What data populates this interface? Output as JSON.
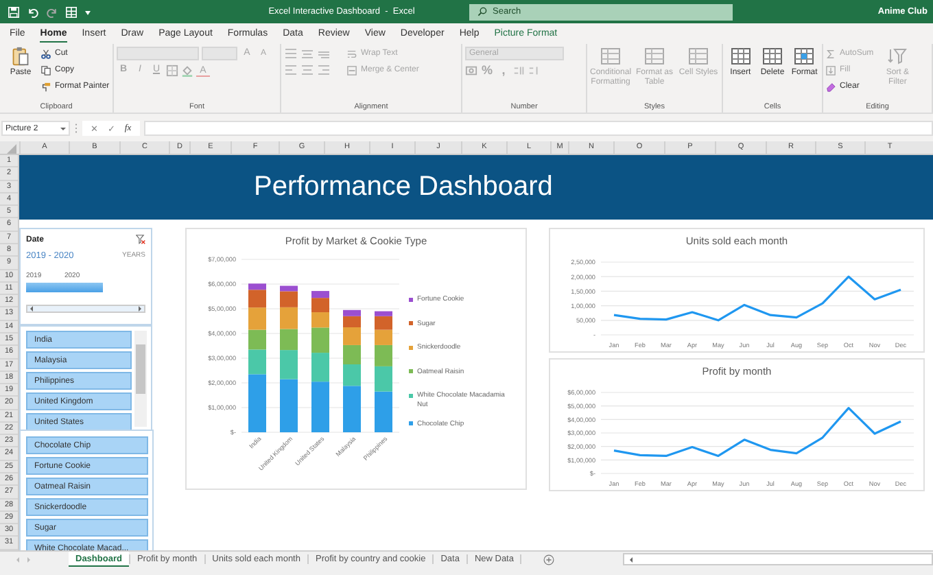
{
  "title_bar": {
    "quick_access": [
      {
        "kind": "save",
        "disabled": false
      },
      {
        "kind": "undo",
        "disabled": false
      },
      {
        "kind": "redo",
        "disabled": true
      },
      {
        "kind": "form",
        "disabled": false
      }
    ],
    "title": "Excel Interactive Dashboard  -  Excel",
    "search": {
      "placeholder": "Search"
    },
    "account": "Anime Club"
  },
  "menu_tabs": [
    {
      "label": "File",
      "selected": false,
      "contextual": false
    },
    {
      "label": "Home",
      "selected": true,
      "contextual": false
    },
    {
      "label": "Insert",
      "selected": false,
      "contextual": false
    },
    {
      "label": "Draw",
      "selected": false,
      "contextual": false
    },
    {
      "label": "Page Layout",
      "selected": false,
      "contextual": false
    },
    {
      "label": "Formulas",
      "selected": false,
      "contextual": false
    },
    {
      "label": "Data",
      "selected": false,
      "contextual": false
    },
    {
      "label": "Review",
      "selected": false,
      "contextual": false
    },
    {
      "label": "View",
      "selected": false,
      "contextual": false
    },
    {
      "label": "Developer",
      "selected": false,
      "contextual": false
    },
    {
      "label": "Help",
      "selected": false,
      "contextual": false
    },
    {
      "label": "Picture Format",
      "selected": false,
      "contextual": true
    }
  ],
  "ribbon": {
    "clipboard": {
      "label": "Clipboard",
      "paste": {
        "label": "Paste",
        "disabled": false
      },
      "tools": [
        {
          "label": "Cut",
          "disabled": false
        },
        {
          "label": "Copy",
          "disabled": false
        },
        {
          "label": "Format Painter",
          "disabled": false
        }
      ]
    },
    "font": {
      "label": "Font",
      "fields_disabled": true,
      "grow": "A",
      "shrink": "A",
      "styles": [
        {
          "label": "B",
          "disabled": true
        },
        {
          "label": "I",
          "disabled": true
        },
        {
          "label": "U",
          "disabled": true
        }
      ],
      "font_color": "A"
    },
    "alignment": {
      "label": "Alignment",
      "wrap_text": {
        "label": "Wrap Text",
        "disabled": true
      },
      "merge": {
        "label": "Merge & Center",
        "disabled": true
      }
    },
    "number": {
      "label": "Number",
      "format": {
        "value": "General",
        "disabled": true
      },
      "percent": "%",
      "comma": ","
    },
    "styles": {
      "label": "Styles",
      "buttons": [
        {
          "label": "Conditional Formatting",
          "disabled": true
        },
        {
          "label": "Format as Table",
          "disabled": true
        },
        {
          "label": "Cell Styles",
          "disabled": true
        }
      ]
    },
    "cells": {
      "label": "Cells",
      "buttons": [
        {
          "label": "Insert",
          "disabled": false
        },
        {
          "label": "Delete",
          "disabled": false
        },
        {
          "label": "Format",
          "disabled": false
        }
      ]
    },
    "editing": {
      "label": "Editing",
      "tools": [
        {
          "label": "AutoSum",
          "disabled": true
        },
        {
          "label": "Fill",
          "disabled": true
        },
        {
          "label": "Clear",
          "disabled": false
        }
      ],
      "sort_filter": {
        "label": "Sort & Filter",
        "disabled": true
      }
    }
  },
  "formula_bar": {
    "name_box": "Picture 2",
    "cancel": "✕",
    "enter": "✓",
    "function": "fx"
  },
  "sheet": {
    "columns": [
      "A",
      "B",
      "C",
      "D",
      "E",
      "F",
      "G",
      "H",
      "I",
      "J",
      "K",
      "L",
      "M",
      "N",
      "O",
      "P",
      "Q",
      "R",
      "S",
      "T"
    ],
    "rows": [
      "1",
      "2",
      "3",
      "4",
      "5",
      "6",
      "7",
      "8",
      "9",
      "10",
      "11",
      "12",
      "13",
      "14",
      "15",
      "16",
      "17",
      "18",
      "19",
      "20",
      "21",
      "22",
      "23",
      "24",
      "25",
      "26",
      "27",
      "28",
      "29",
      "30",
      "31"
    ],
    "banner": "Performance Dashboard",
    "date_slicer": {
      "title": "Date",
      "range": "2019 - 2020",
      "period": "YEARS",
      "years": [
        {
          "label": "2019",
          "selected": true
        },
        {
          "label": "2020",
          "selected": true
        }
      ]
    },
    "country_slicer": {
      "items": [
        {
          "label": "India",
          "selected": true
        },
        {
          "label": "Malaysia",
          "selected": true
        },
        {
          "label": "Philippines",
          "selected": true
        },
        {
          "label": "United Kingdom",
          "selected": true
        },
        {
          "label": "United States",
          "selected": true
        }
      ]
    },
    "cookie_slicer": {
      "items": [
        {
          "label": "Chocolate Chip",
          "selected": true
        },
        {
          "label": "Fortune Cookie",
          "selected": true
        },
        {
          "label": "Oatmeal Raisin",
          "selected": true
        },
        {
          "label": "Snickerdoodle",
          "selected": true
        },
        {
          "label": "Sugar",
          "selected": true
        },
        {
          "label": "White Chocolate Macad...",
          "selected": true
        }
      ]
    },
    "charts": [
      {
        "chart_data": {
          "type": "bar",
          "title": "Profit by Market & Cookie Type",
          "stacked": true,
          "grid": true,
          "legend": "right",
          "categories": [
            "India",
            "United Kingdom",
            "United States",
            "Malaysia",
            "Philippines"
          ],
          "ylim": [
            0,
            700000
          ],
          "yticks": [
            {
              "value": 0,
              "label": "$-"
            },
            {
              "value": 100000,
              "label": "$1,00,000"
            },
            {
              "value": 200000,
              "label": "$2,00,000"
            },
            {
              "value": 300000,
              "label": "$3,00,000"
            },
            {
              "value": 400000,
              "label": "$4,00,000"
            },
            {
              "value": 500000,
              "label": "$5,00,000"
            },
            {
              "value": 600000,
              "label": "$6,00,000"
            },
            {
              "value": 700000,
              "label": "$7,00,000"
            }
          ],
          "series": [
            {
              "name": "Chocolate Chip",
              "color": "#2e9fe8",
              "values": [
                235000,
                215000,
                205000,
                188000,
                165000
              ]
            },
            {
              "name": "White Chocolate Macadamia Nut",
              "color": "#4bc8a8",
              "values": [
                100000,
                118000,
                117000,
                87000,
                102000
              ]
            },
            {
              "name": "Oatmeal Raisin",
              "color": "#7dbb55",
              "values": [
                80000,
                85000,
                102000,
                78000,
                86000
              ]
            },
            {
              "name": "Snickerdoodle",
              "color": "#e5a23a",
              "values": [
                90000,
                88000,
                62000,
                72000,
                62000
              ]
            },
            {
              "name": "Sugar",
              "color": "#d2632a",
              "values": [
                72000,
                65000,
                58000,
                45000,
                55000
              ]
            },
            {
              "name": "Fortune Cookie",
              "color": "#9b4fd0",
              "values": [
                25000,
                22000,
                28000,
                25000,
                20000
              ]
            }
          ]
        }
      },
      {
        "chart_data": {
          "type": "line",
          "title": "Units sold each month",
          "grid": true,
          "categories": [
            "Jan",
            "Feb",
            "Mar",
            "Apr",
            "May",
            "Jun",
            "Jul",
            "Aug",
            "Sep",
            "Oct",
            "Nov",
            "Dec"
          ],
          "ylim": [
            0,
            250000
          ],
          "yticks": [
            {
              "value": 0,
              "label": "-"
            },
            {
              "value": 50000,
              "label": "50,000"
            },
            {
              "value": 100000,
              "label": "1,00,000"
            },
            {
              "value": 150000,
              "label": "1,50,000"
            },
            {
              "value": 200000,
              "label": "2,00,000"
            },
            {
              "value": 250000,
              "label": "2,50,000"
            }
          ],
          "series": [
            {
              "color": "#1f97f0",
              "values": [
                68000,
                55000,
                53000,
                78000,
                50000,
                103000,
                68000,
                60000,
                108000,
                200000,
                122000,
                155000
              ]
            }
          ]
        }
      },
      {
        "chart_data": {
          "type": "line",
          "title": "Profit by month",
          "grid": true,
          "categories": [
            "Jan",
            "Feb",
            "Mar",
            "Apr",
            "May",
            "Jun",
            "Jul",
            "Aug",
            "Sep",
            "Oct",
            "Nov",
            "Dec"
          ],
          "ylim": [
            0,
            600000
          ],
          "yticks": [
            {
              "value": 0,
              "label": "$-"
            },
            {
              "value": 100000,
              "label": "$1,00,000"
            },
            {
              "value": 200000,
              "label": "$2,00,000"
            },
            {
              "value": 300000,
              "label": "$3,00,000"
            },
            {
              "value": 400000,
              "label": "$4,00,000"
            },
            {
              "value": 500000,
              "label": "$5,00,000"
            },
            {
              "value": 600000,
              "label": "$6,00,000"
            }
          ],
          "series": [
            {
              "color": "#1f97f0",
              "values": [
                170000,
                135000,
                130000,
                195000,
                130000,
                250000,
                175000,
                150000,
                265000,
                485000,
                295000,
                385000
              ]
            }
          ]
        }
      }
    ]
  },
  "sheet_tabs": [
    {
      "label": "Dashboard",
      "selected": true
    },
    {
      "label": "Profit by month",
      "selected": false
    },
    {
      "label": "Units sold each month",
      "selected": false
    },
    {
      "label": "Profit by country and cookie",
      "selected": false
    },
    {
      "label": "Data",
      "selected": false
    },
    {
      "label": "New Data",
      "selected": false
    }
  ]
}
